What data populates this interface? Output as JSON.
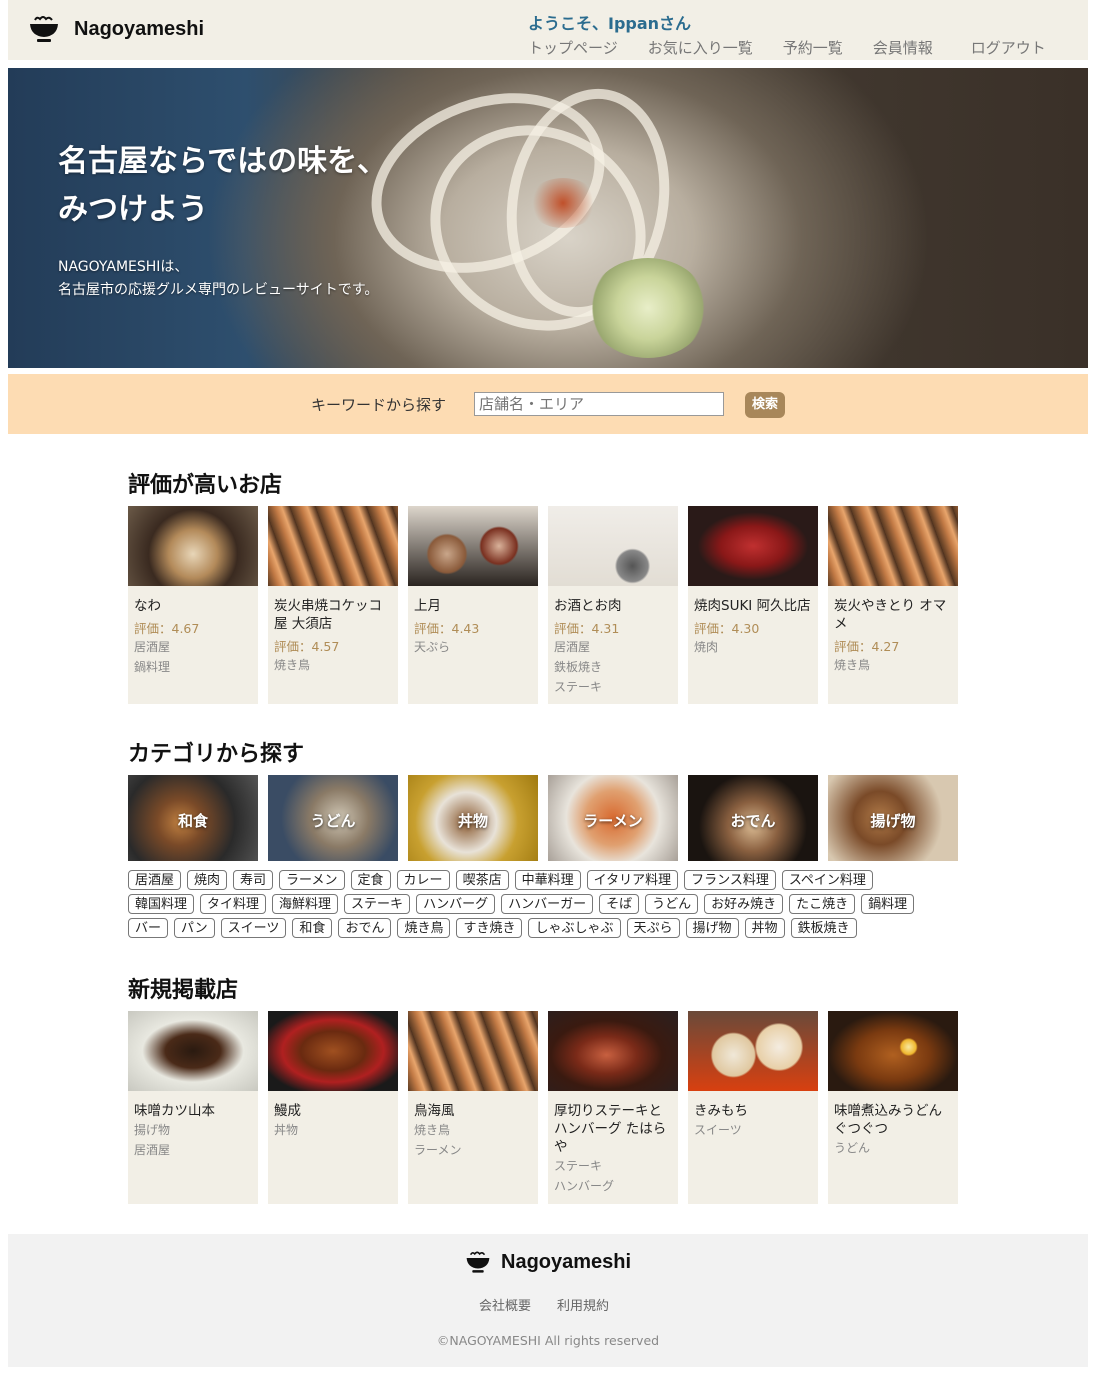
{
  "header": {
    "logo": "Nagoyameshi",
    "welcome": "ようこそ、Ippanさん",
    "nav": [
      "トップページ",
      "お気に入り一覧",
      "予約一覧",
      "会員情報",
      "ログアウト"
    ]
  },
  "hero": {
    "title_line1": "名古屋ならではの味を、",
    "title_line2": "みつけよう",
    "desc_line1": "NAGOYAMESHIは、",
    "desc_line2": "名古屋市の応援グルメ専門のレビューサイトです。"
  },
  "search": {
    "label": "キーワードから探す",
    "placeholder": "店舗名・エリア",
    "button": "検索"
  },
  "top_rated": {
    "title": "評価が高いお店",
    "items": [
      {
        "name": "なわ",
        "rating": "評価：4.67",
        "cats": [
          "居酒屋",
          "鍋料理"
        ]
      },
      {
        "name": "炭火串焼コケッコ屋 大須店",
        "rating": "評価：4.57",
        "cats": [
          "焼き鳥"
        ]
      },
      {
        "name": "上月",
        "rating": "評価：4.43",
        "cats": [
          "天ぷら"
        ]
      },
      {
        "name": "お酒とお肉",
        "rating": "評価：4.31",
        "cats": [
          "居酒屋",
          "鉄板焼き",
          "ステーキ"
        ]
      },
      {
        "name": "焼肉SUKI 阿久比店",
        "rating": "評価：4.30",
        "cats": [
          "焼肉"
        ]
      },
      {
        "name": "炭火やきとり オマメ",
        "rating": "評価：4.27",
        "cats": [
          "焼き鳥"
        ]
      }
    ]
  },
  "categories": {
    "title": "カテゴリから探す",
    "featured": [
      "和食",
      "うどん",
      "丼物",
      "ラーメン",
      "おでん",
      "揚げ物"
    ],
    "tags_row1": [
      "居酒屋",
      "焼肉",
      "寿司",
      "ラーメン",
      "定食",
      "カレー",
      "喫茶店",
      "中華料理",
      "イタリア料理",
      "フランス料理",
      "スペイン料理"
    ],
    "tags_row2": [
      "韓国料理",
      "タイ料理",
      "海鮮料理",
      "ステーキ",
      "ハンバーグ",
      "ハンバーガー",
      "そば",
      "うどん",
      "お好み焼き",
      "たこ焼き",
      "鍋料理"
    ],
    "tags_row3": [
      "バー",
      "パン",
      "スイーツ",
      "和食",
      "おでん",
      "焼き鳥",
      "すき焼き",
      "しゃぶしゃぶ",
      "天ぷら",
      "揚げ物",
      "丼物",
      "鉄板焼き"
    ]
  },
  "new_shops": {
    "title": "新規掲載店",
    "items": [
      {
        "name": "味噌カツ山本",
        "cats": [
          "揚げ物",
          "居酒屋"
        ]
      },
      {
        "name": "鰻成",
        "cats": [
          "丼物"
        ]
      },
      {
        "name": "鳥海風",
        "cats": [
          "焼き鳥",
          "ラーメン"
        ]
      },
      {
        "name": "厚切りステーキとハンバーグ たはらや",
        "cats": [
          "ステーキ",
          "ハンバーグ"
        ]
      },
      {
        "name": "きみもち",
        "cats": [
          "スイーツ"
        ]
      },
      {
        "name": "味噌煮込みうどん ぐつぐつ",
        "cats": [
          "うどん"
        ]
      }
    ]
  },
  "footer": {
    "logo": "Nagoyameshi",
    "links": [
      "会社概要",
      "利用規約"
    ],
    "copyright": "©NAGOYAMESHI All rights reserved"
  },
  "colors": {
    "accent": "#a8875a",
    "welcome": "#2b6c8f",
    "search_band": "#fddcb3",
    "card_bg": "#f2efe6"
  },
  "icons": [
    "bowl-logo-icon"
  ]
}
